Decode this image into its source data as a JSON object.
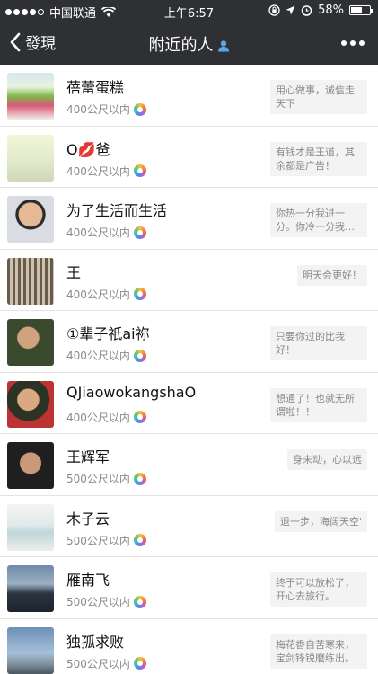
{
  "status_bar": {
    "carrier": "中国联通",
    "time": "上午6:57",
    "battery": "58%",
    "battery_level": 0.58
  },
  "nav": {
    "back_label": "發現",
    "title": "附近的人"
  },
  "people": [
    {
      "name": "蓓蕾蛋糕",
      "distance": "400公尺以内",
      "signature": "用心做事，诚信走天下",
      "avatar": "cake"
    },
    {
      "name": "O💋爸",
      "distance": "400公尺以内",
      "signature": "有钱才是王道，其余都是广告！",
      "avatar": "hands"
    },
    {
      "name": "为了生活而生活",
      "distance": "400公尺以内",
      "signature": "你热一分我进一分。你冷一分我…",
      "avatar": "man1"
    },
    {
      "name": "王",
      "distance": "400公尺以内",
      "signature": "明天会更好！",
      "avatar": "gate"
    },
    {
      "name": "①辈子祇ai祢",
      "distance": "400公尺以内",
      "signature": "只要你过的比我好！",
      "avatar": "man2"
    },
    {
      "name": "QJiaowokangshaO",
      "distance": "400公尺以内",
      "signature": "想通了！也就无所谓啦！！",
      "avatar": "man3"
    },
    {
      "name": "王辉军",
      "distance": "500公尺以内",
      "signature": "身未动，心以远",
      "avatar": "man4"
    },
    {
      "name": "木子云",
      "distance": "500公尺以内",
      "signature": "退一步，海阔天空'",
      "avatar": "sea"
    },
    {
      "name": "雁南飞",
      "distance": "500公尺以内",
      "signature": "终于可以放松了，开心去旅行。",
      "avatar": "car"
    },
    {
      "name": "独孤求败",
      "distance": "500公尺以内",
      "signature": "梅花香自苦寒来，宝剑锋锐磨练出。",
      "avatar": "wind"
    }
  ]
}
